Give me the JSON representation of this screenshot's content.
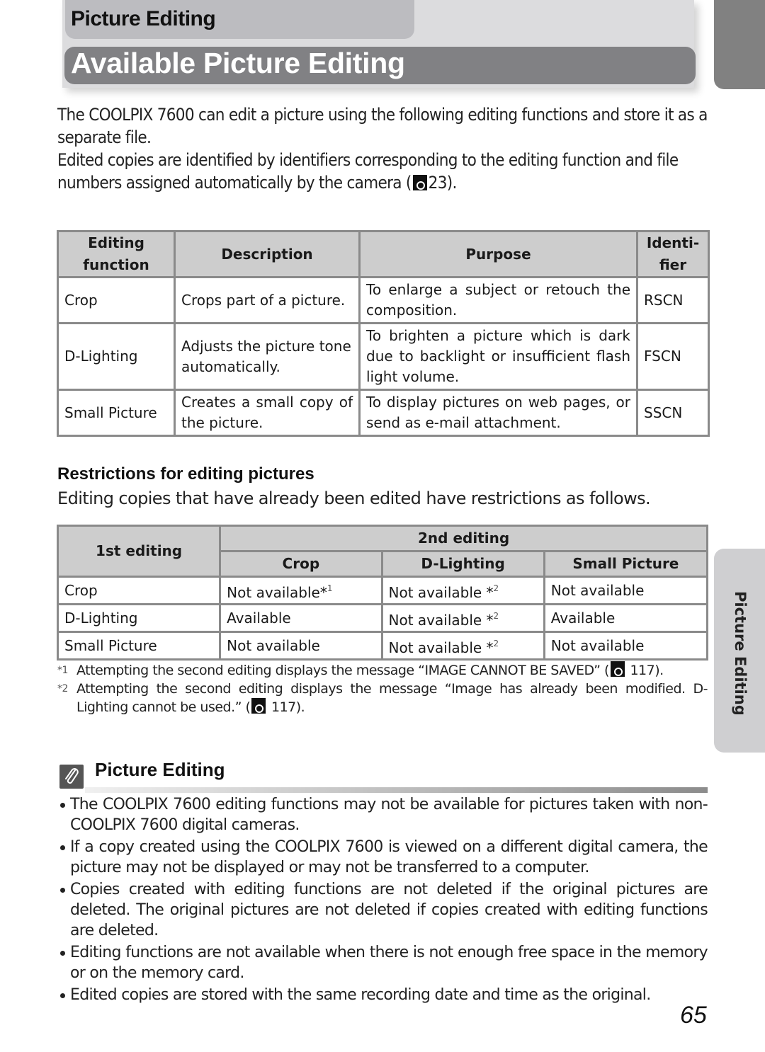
{
  "header": {
    "section": "Picture Editing",
    "title": "Available Picture Editing"
  },
  "side_tab": "Picture Editing",
  "intro": {
    "p1": "The COOLPIX 7600 can edit a picture using the following editing functions and store it as a separate file.",
    "p2_before": "Edited copies are identified by identifiers corresponding to the editing function and file numbers assigned automatically by the camera (",
    "p2_ref": "23",
    "p2_after": ")."
  },
  "functions_table": {
    "headers": [
      "Editing function",
      "Description",
      "Purpose",
      "Identi- fier"
    ],
    "rows": [
      {
        "function": "Crop",
        "description": "Crops part of a picture.",
        "purpose": "To enlarge a subject or retouch the composition.",
        "identifier": "RSCN"
      },
      {
        "function": "D-Lighting",
        "description": "Adjusts the picture tone automatically.",
        "purpose": "To brighten a picture which is dark due to backlight or insufficient flash light volume.",
        "identifier": "FSCN"
      },
      {
        "function": "Small Picture",
        "description": "Creates a small copy of the picture.",
        "purpose": "To display pictures on web pages, or send as e-mail attachment.",
        "identifier": "SSCN"
      }
    ]
  },
  "restrictions": {
    "heading": "Restrictions for editing pictures",
    "text": "Editing copies that have already been edited have restrictions as follows.",
    "table": {
      "first_header": "1st editing",
      "second_header": "2nd editing",
      "columns": [
        "Crop",
        "D-Lighting",
        "Small Picture"
      ],
      "rows": [
        {
          "first": "Crop",
          "cells": [
            {
              "text": "Not available",
              "note": "*",
              "sup": "1"
            },
            {
              "text": "Not available ",
              "note": "*",
              "sup": "2"
            },
            {
              "text": "Not available",
              "note": "",
              "sup": ""
            }
          ]
        },
        {
          "first": "D-Lighting",
          "cells": [
            {
              "text": "Available",
              "note": "",
              "sup": ""
            },
            {
              "text": "Not available ",
              "note": "*",
              "sup": "2"
            },
            {
              "text": "Available",
              "note": "",
              "sup": ""
            }
          ]
        },
        {
          "first": "Small Picture",
          "cells": [
            {
              "text": "Not available",
              "note": "",
              "sup": ""
            },
            {
              "text": "Not available ",
              "note": "*",
              "sup": "2"
            },
            {
              "text": "Not available",
              "note": "",
              "sup": ""
            }
          ]
        }
      ]
    },
    "footnotes": [
      {
        "mark": "*1",
        "text": "Attempting the second editing displays the message “IMAGE CANNOT BE SAVED” (",
        "ref": "117",
        "after": ")."
      },
      {
        "mark": "*2",
        "text": "Attempting the second editing displays the message “Image has already been modified. D-Lighting cannot be used.” (",
        "ref": "117",
        "after": ")."
      }
    ]
  },
  "note": {
    "icon": "paperclip-icon",
    "title": "Picture Editing",
    "items": [
      "The COOLPIX 7600 editing functions may not be available for pictures taken with non-COOLPIX 7600 digital cameras.",
      "If a copy created using the COOLPIX 7600 is viewed on a different digital camera, the picture may not be displayed or may not be transferred to a computer.",
      "Copies created with editing functions are not deleted if the original pictures are deleted. The original pictures are not deleted if copies created with editing functions are deleted.",
      "Editing functions are not available when there is not enough free space in the memory or on the memory card.",
      "Edited copies are stored with the same recording date and time as the original."
    ]
  },
  "page_number": "65"
}
